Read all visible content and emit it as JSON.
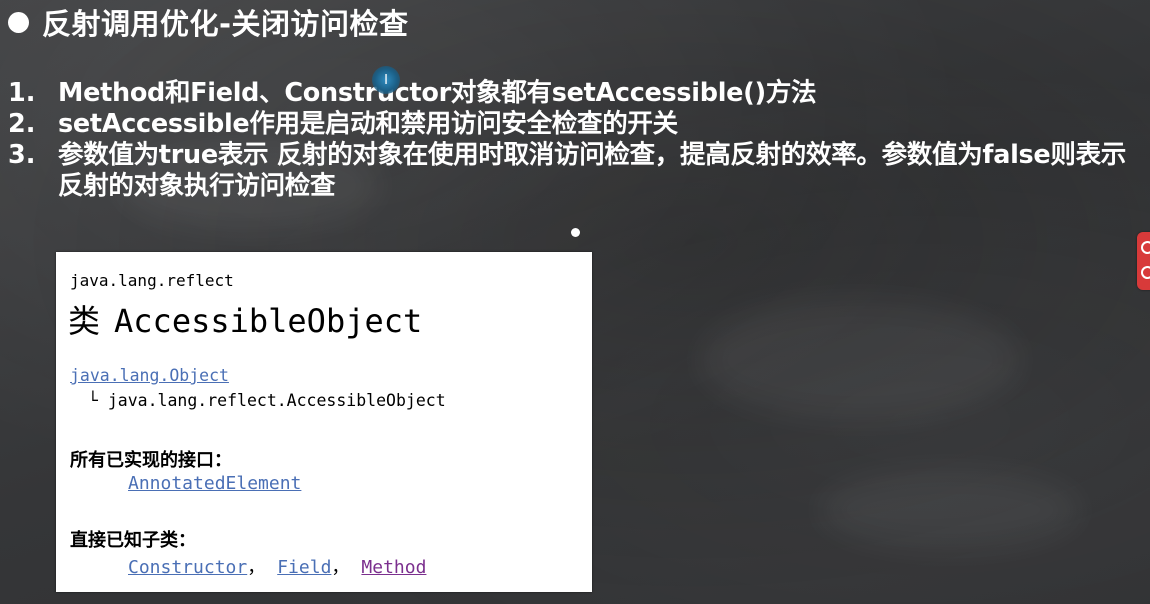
{
  "slide": {
    "title": "反射调用优化-关闭访问检查",
    "points": [
      {
        "num": "1.",
        "text": "Method和Field、Constructor对象都有setAccessible()方法"
      },
      {
        "num": "2.",
        "text": "setAccessible作用是启动和禁用访问安全检查的开关"
      },
      {
        "num": "3.",
        "text": "参数值为true表示 反射的对象在使用时取消访问检查，提高反射的效率。参数值为false则表示反射的对象执行访问检查"
      }
    ]
  },
  "doc": {
    "package": "java.lang.reflect",
    "class_keyword": "类",
    "class_name": "AccessibleObject",
    "parent_link": "java.lang.Object",
    "child_prefix": "└",
    "child": "java.lang.reflect.AccessibleObject",
    "interfaces_heading": "所有已实现的接口：",
    "interfaces": [
      "AnnotatedElement"
    ],
    "subclasses_heading": "直接已知子类：",
    "subclasses": [
      "Constructor",
      "Field",
      "Method"
    ],
    "separator": "，"
  },
  "overlay": {
    "cursor_icon": "text-cursor-icon",
    "cursor_glyph": "I",
    "side_tab_icon": "red-side-tab-icon"
  },
  "colors": {
    "background": "#3a3b3d",
    "link": "#4a6fb5",
    "visited_link": "#7b2f8e",
    "side_tab": "#d83a3a"
  }
}
